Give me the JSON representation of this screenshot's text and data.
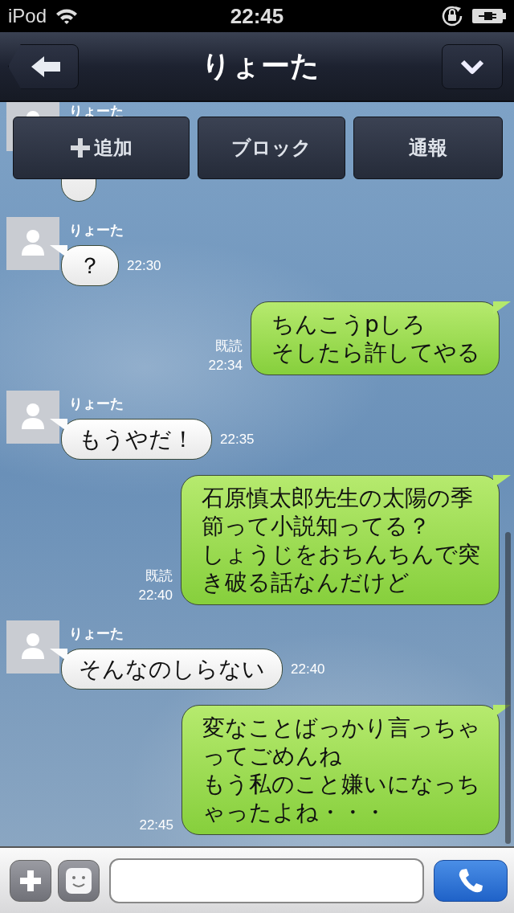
{
  "status_bar": {
    "carrier": "iPod",
    "time": "22:45"
  },
  "header": {
    "title": "りょーた"
  },
  "actions": [
    {
      "kind": "add",
      "label": "追加"
    },
    {
      "kind": "block",
      "label": "ブロック"
    },
    {
      "kind": "report",
      "label": "通報"
    }
  ],
  "messages": [
    {
      "kind": "received",
      "sender": "りょーた"
    },
    {
      "kind": "received",
      "sender": "りょーた",
      "lines": [
        "？"
      ],
      "time": "22:30"
    },
    {
      "kind": "sent",
      "receipt": "既読",
      "lines": [
        "ちんこうpしろ",
        "そしたら許してやる"
      ],
      "time": "22:34"
    },
    {
      "kind": "received",
      "sender": "りょーた",
      "lines": [
        "もうやだ！"
      ],
      "time": "22:35"
    },
    {
      "kind": "sent",
      "receipt": "既読",
      "lines": [
        "石原慎太郎先生の太陽の季",
        "節って小説知ってる？",
        "しょうじをおちんちんで突",
        "き破る話なんだけど"
      ],
      "time": "22:40"
    },
    {
      "kind": "received",
      "sender": "りょーた",
      "lines": [
        "そんなのしらない"
      ],
      "time": "22:40"
    },
    {
      "kind": "sent",
      "lines": [
        "変なことばっかり言っちゃ",
        "ってごめんね",
        "もう私のこと嫌いになっち",
        "ゃったよね・・・"
      ],
      "time": "22:45"
    }
  ]
}
